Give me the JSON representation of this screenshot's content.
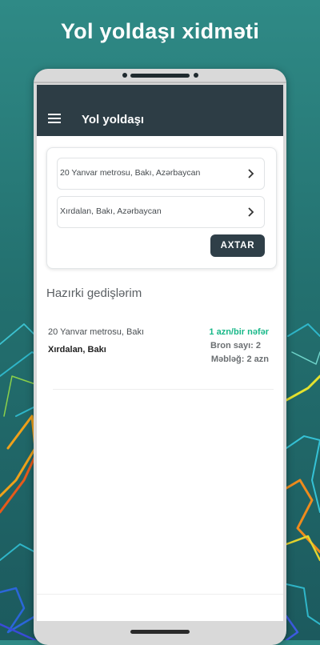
{
  "headline": "Yol yoldaşı xidməti",
  "appbar": {
    "title": "Yol yoldaşı",
    "menu_icon": "hamburger-menu-icon"
  },
  "search": {
    "origin": "20 Yanvar metrosu, Bakı, Azərbaycan",
    "destination": "Xırdalan, Bakı, Azərbaycan",
    "button_label": "AXTAR"
  },
  "current_trips": {
    "title": "Hazırki gedişlərim",
    "trips": [
      {
        "from": "20 Yanvar metrosu, Bakı",
        "to": "Xırdalan, Bakı",
        "price": "1 azn/bir nəfər",
        "bookings": "Bron sayı: 2",
        "amount": "Məbləğ: 2 azn"
      }
    ]
  },
  "colors": {
    "background": "#2a7d7b",
    "appbar": "#2d3d45",
    "button": "#2f3f48",
    "price": "#19b889"
  }
}
